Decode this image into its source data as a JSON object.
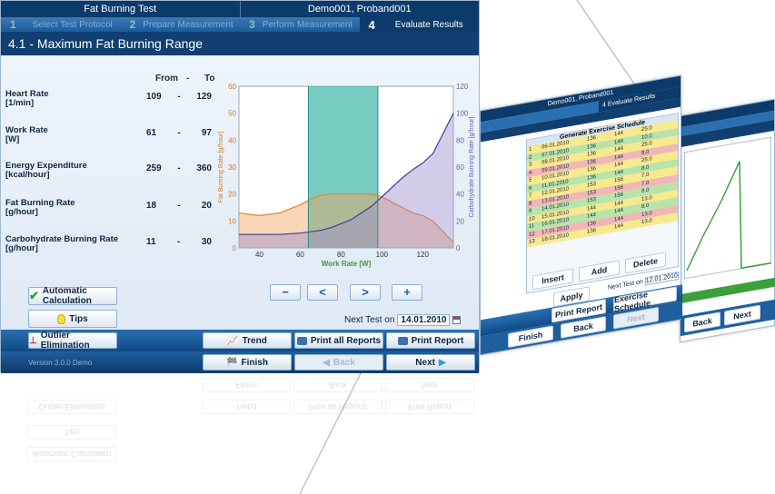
{
  "window": {
    "title": "Fat Burning Test",
    "subject": "Demo001, Proband001"
  },
  "steps": [
    {
      "num": "1",
      "label": "Select Test Protocol"
    },
    {
      "num": "2",
      "label": "Prepare Measurement"
    },
    {
      "num": "3",
      "label": "Perform Measurement"
    },
    {
      "num": "4",
      "label": "Evaluate Results"
    }
  ],
  "page_title": "4.1 - Maximum Fat Burning Range",
  "table": {
    "from_label": "From",
    "dash": "-",
    "to_label": "To",
    "rows": [
      {
        "name": "Heart Rate",
        "unit": "[1/min]",
        "from": "109",
        "to": "129"
      },
      {
        "name": "Work Rate",
        "unit": "[W]",
        "from": "61",
        "to": "97"
      },
      {
        "name": "Energy Expenditure",
        "unit": "[kcal/hour]",
        "from": "259",
        "to": "360"
      },
      {
        "name": "Fat Burning Rate",
        "unit": "[g/hour]",
        "from": "18",
        "to": "20"
      },
      {
        "name": "Carbohydrate Burning Rate",
        "unit": "[g/hour]",
        "from": "11",
        "to": "30"
      }
    ]
  },
  "chart_data": {
    "type": "area",
    "xlabel": "Work Rate [W]",
    "ylabel": "Fat Burning Rate [g/hour]",
    "y2label": "Carbohydrate Burning Rate [g/hour]",
    "xlim": [
      30,
      135
    ],
    "xticks": [
      40,
      60,
      80,
      100,
      120
    ],
    "ylim": [
      0,
      60
    ],
    "yticks": [
      0,
      10,
      20,
      30,
      40,
      50,
      60
    ],
    "y2lim": [
      0,
      120
    ],
    "y2ticks": [
      0,
      20,
      40,
      60,
      80,
      100,
      120
    ],
    "highlight_range": [
      64,
      98
    ],
    "series": [
      {
        "axis": "left",
        "color": "#f0a460",
        "x": [
          30,
          40,
          50,
          60,
          65,
          70,
          75,
          80,
          85,
          90,
          95,
          100,
          105,
          110,
          115,
          120,
          125,
          130,
          135
        ],
        "values": [
          13,
          12,
          13,
          16,
          18,
          19.5,
          20,
          20,
          20,
          20,
          20,
          19,
          17,
          15,
          13,
          12,
          10,
          6,
          2
        ]
      },
      {
        "axis": "right",
        "color": "#9d8fcf",
        "x": [
          30,
          40,
          50,
          60,
          65,
          70,
          75,
          80,
          85,
          90,
          95,
          100,
          105,
          110,
          115,
          120,
          125,
          130,
          135
        ],
        "values": [
          10,
          10,
          10,
          11,
          12,
          13,
          15,
          18,
          21,
          26,
          31,
          38,
          45,
          52,
          58,
          63,
          70,
          85,
          100
        ]
      }
    ]
  },
  "nav_buttons": {
    "zoom_out": "−",
    "prev": "<",
    "next": ">",
    "zoom_in": "+"
  },
  "buttons": {
    "auto_calc": "Automatic Calculation",
    "tips": "Tips",
    "outlier": "Outlier Elimination",
    "trend": "Trend",
    "print_all": "Print all Reports",
    "print_report": "Print Report",
    "finish": "Finish",
    "back": "Back",
    "next": "Next"
  },
  "next_test": {
    "label": "Next Test on",
    "date": "14.01.2010"
  },
  "version": "Version 3.0.0 Demo",
  "colors": {
    "accent": "#0c3a6b",
    "fat_area": "#f0a460",
    "carb_area": "#9d8fcf",
    "highlight": "#3fb6a8"
  },
  "bg_screen1": {
    "subject": "Demo001, Proband001",
    "step_label": "Evaluate Results",
    "step_num": "4",
    "table_title": "Generate Exercise Schedule",
    "buttons": {
      "insert": "Insert",
      "add": "Add",
      "delete": "Delete",
      "apply": "Apply",
      "print_report": "Print Report",
      "exercise_schedule": "Exercise Schedule",
      "finish": "Finish",
      "back": "Back",
      "next": "Next"
    },
    "next_test_label": "Next Test on",
    "next_test_date": "12.01.2010",
    "rows": [
      {
        "no": "1",
        "date": "06.01.2010",
        "value": "136",
        "hr": "144",
        "kcal": "25.0"
      },
      {
        "no": "2",
        "date": "07.01.2010",
        "value": "136",
        "hr": "144",
        "kcal": "10.0"
      },
      {
        "no": "3",
        "date": "08.01.2010",
        "value": "136",
        "hr": "144",
        "kcal": "25.0"
      },
      {
        "no": "4",
        "date": "09.01.2010",
        "value": "136",
        "hr": "144",
        "kcal": "8.0"
      },
      {
        "no": "5",
        "date": "10.01.2010",
        "value": "136",
        "hr": "144",
        "kcal": "25.0"
      },
      {
        "no": "6",
        "date": "11.01.2010",
        "value": "136",
        "hr": "144",
        "kcal": "8.0"
      },
      {
        "no": "7",
        "date": "12.01.2010",
        "value": "153",
        "hr": "156",
        "kcal": "7.0"
      },
      {
        "no": "8",
        "date": "13.01.2010",
        "value": "153",
        "hr": "156",
        "kcal": "7.0"
      },
      {
        "no": "9",
        "date": "14.01.2010",
        "value": "153",
        "hr": "156",
        "kcal": "8.0"
      },
      {
        "no": "10",
        "date": "15.01.2010",
        "value": "144",
        "hr": "144",
        "kcal": "13.0"
      },
      {
        "no": "11",
        "date": "16.01.2010",
        "value": "144",
        "hr": "144",
        "kcal": "8.0"
      },
      {
        "no": "12",
        "date": "17.01.2010",
        "value": "136",
        "hr": "144",
        "kcal": "13.0"
      },
      {
        "no": "13",
        "date": "18.01.2010",
        "value": "136",
        "hr": "144",
        "kcal": "13.0"
      }
    ]
  },
  "bg_screen2": {
    "buttons": {
      "back": "Back",
      "next": "Next"
    }
  }
}
